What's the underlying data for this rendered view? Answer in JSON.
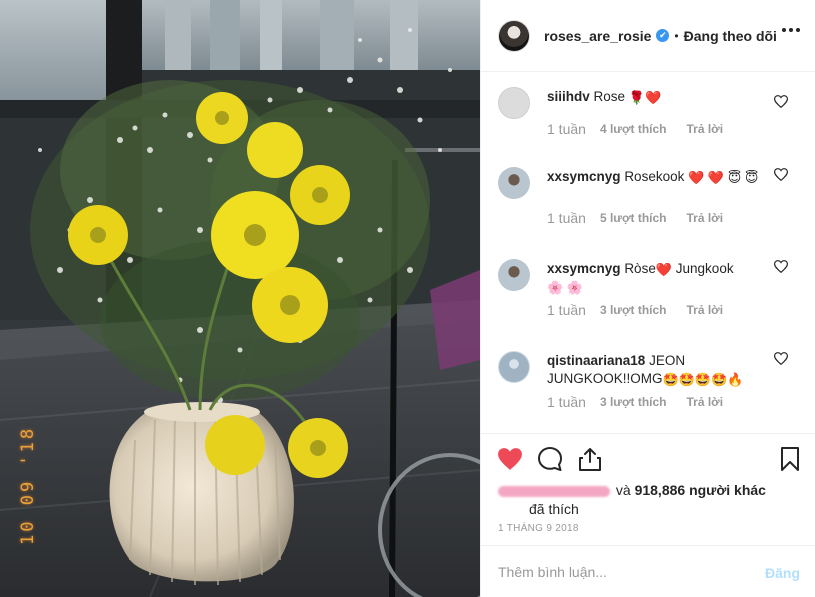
{
  "photo": {
    "date_stamp": "10 09 '18"
  },
  "header": {
    "username": "roses_are_rosie",
    "verified_icon": "✔",
    "separator": "•",
    "follow_status": "Đang theo dõi"
  },
  "comments": [
    {
      "username": "siiihdv",
      "text": "Rose",
      "emoji": "🌹❤️",
      "time": "1 tuần",
      "likes": "4 lượt thích",
      "reply": "Trả lời"
    },
    {
      "username": "xxsymcnyg",
      "text": "Rosekook",
      "emoji": "❤️ ❤️ 😇 😇",
      "time": "1 tuần",
      "likes": "5 lượt thích",
      "reply": "Trả lời"
    },
    {
      "username": "xxsymcnyg",
      "text": "Ròse",
      "emoji_mid": "❤️",
      "text2": "Jungkook",
      "emoji": "🌸 🌸",
      "time": "1 tuần",
      "likes": "3 lượt thích",
      "reply": "Trả lời"
    },
    {
      "username": "qistinaariana18",
      "text": "JEON JUNGKOOK!!OMG",
      "emoji": "🤩🤩🤩🤩🔥",
      "time": "1 tuần",
      "likes": "3 lượt thích",
      "reply": "Trả lời"
    }
  ],
  "actions": {
    "liked_by_suffix": "và",
    "liked_count": "918,886 người khác",
    "liked_line2": "đã thích",
    "post_date": "1 THÁNG 9 2018"
  },
  "add_comment": {
    "placeholder": "Thêm bình luận...",
    "post_label": "Đăng"
  },
  "colors": {
    "accent_blue": "#3897f0",
    "like_red": "#ed4956",
    "post_disabled": "#b2dffc"
  }
}
